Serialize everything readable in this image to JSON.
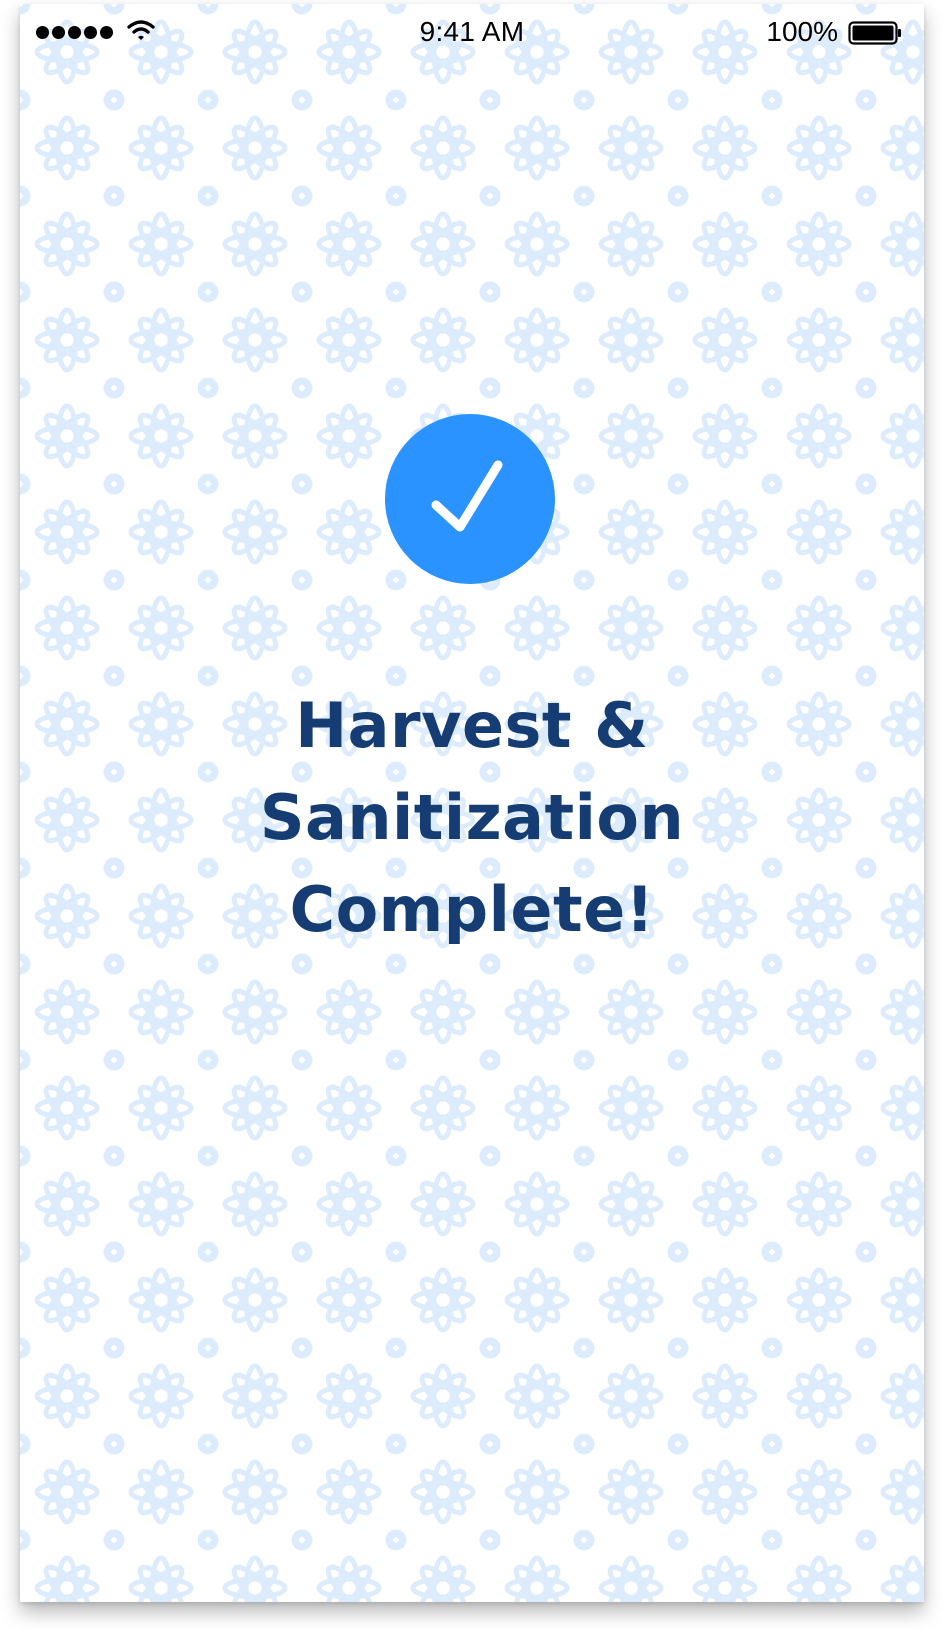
{
  "status_bar": {
    "time": "9:41 AM",
    "battery_percent": "100%",
    "signal_icon": "signal-dots-icon",
    "wifi_icon": "wifi-icon",
    "battery_icon": "battery-icon",
    "battery_level": 1.0
  },
  "main": {
    "icon": "checkmark-icon",
    "title_lines": [
      "Harvest &",
      "Sanitization",
      "Complete!"
    ]
  },
  "colors": {
    "accent": "#2b93ff",
    "title": "#153d73",
    "pattern": "#dcecfd",
    "background": "#ffffff"
  }
}
